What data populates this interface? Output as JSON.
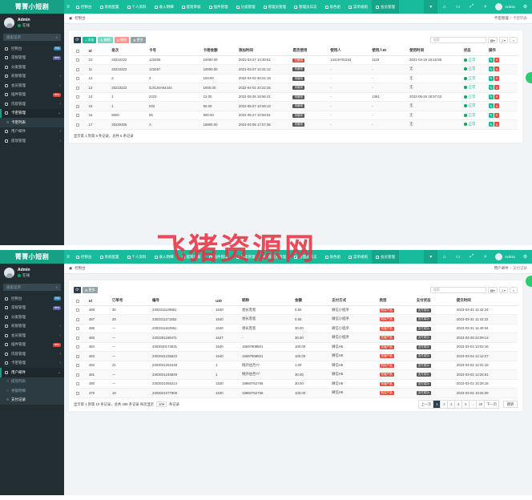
{
  "colors": {
    "accent": "#18bc9c",
    "sidebar": "#222d32",
    "danger": "#e74c3c",
    "dark": "#2c3e50"
  },
  "watermark": "飞猪资源网",
  "shot1": {
    "brand": "菁菁小短剧",
    "user": {
      "name": "Admin",
      "status": "在线"
    },
    "search_placeholder": "搜索菜单",
    "menu": [
      {
        "label": "控制台",
        "badge": "hot",
        "badge_color": "#3c8dbc"
      },
      {
        "label": "常规管理",
        "badge": "new",
        "badge_color": "#605ca8"
      },
      {
        "label": "分类管理",
        "badge": "",
        "badge_color": ""
      },
      {
        "label": "权限管理",
        "badge": "",
        "badge_color": "",
        "chev": true
      },
      {
        "label": "会员管理",
        "badge": "",
        "badge_color": "",
        "chev": true
      },
      {
        "label": "插件管理",
        "badge": "new",
        "badge_color": "#dd4b39"
      },
      {
        "label": "内容管理",
        "badge": "",
        "badge_color": "",
        "chev": true
      },
      {
        "label": "卡密管理",
        "badge": "",
        "badge_color": "",
        "chev": true,
        "active": true
      }
    ],
    "submenu": [
      {
        "label": "卡密列表",
        "current": true
      }
    ],
    "menu_after": [
      {
        "label": "用户邮件",
        "badge": "",
        "badge_color": "",
        "chev": true
      },
      {
        "label": "提现管理",
        "badge": "",
        "badge_color": "",
        "chev": true
      }
    ],
    "tabs": [
      {
        "label": "控制台",
        "icon": "dashboard-icon"
      },
      {
        "label": "系统配置",
        "icon": "cog-icon"
      },
      {
        "label": "个人资料",
        "icon": "user-icon"
      },
      {
        "label": "收入明细",
        "icon": "list-icon"
      },
      {
        "label": "提现审核",
        "icon": "money-icon"
      },
      {
        "label": "插件管理",
        "icon": "plugin-icon"
      },
      {
        "label": "分类管理",
        "icon": "category-icon"
      },
      {
        "label": "管理员管理",
        "icon": "admin-icon"
      },
      {
        "label": "管理员日志",
        "icon": "log-icon"
      },
      {
        "label": "角色组",
        "icon": "group-icon"
      },
      {
        "label": "菜单规则",
        "icon": "menu-icon"
      },
      {
        "label": "会员管理",
        "icon": "member-icon"
      }
    ],
    "active_tab": 11,
    "top_user": "Admin",
    "crumb": {
      "title": "控制台",
      "right": [
        "卡密管理",
        "卡密列表"
      ]
    },
    "toolbar": {
      "add": "添加",
      "edit": "编辑",
      "del": "删除",
      "more": "更多",
      "search": "搜索"
    },
    "columns": [
      "Id",
      "批次",
      "卡号",
      "卡密金额",
      "添加时间",
      "是否使用",
      "使用人",
      "使用人ID",
      "使用时间",
      "状态",
      "操作"
    ],
    "rows": [
      [
        "10",
        "20210222",
        "123456",
        "10000.00",
        "2021-03-27 14:30:51",
        "已使用",
        "13416781153",
        "1119",
        "2021-04-19 16:16:55",
        "正常"
      ],
      [
        "11",
        "20210222",
        "123457",
        "10000.00",
        "2021-03-27 14:31:12",
        "未使用",
        "-",
        "-",
        "无",
        "正常"
      ],
      [
        "12",
        "2",
        "3",
        "100.00",
        "2022-04-02 20:21:19",
        "未使用",
        "-",
        "-",
        "无",
        "正常"
      ],
      [
        "13",
        "20210222",
        "GJGJSA54444",
        "1000.00",
        "2022-04-02 20:22:25",
        "未使用",
        "-",
        "-",
        "无",
        "正常"
      ],
      [
        "14",
        "1",
        "2222",
        "12.00",
        "2022-05-26 18:56:41",
        "未使用",
        "-",
        "1361",
        "2022-05-26 18:57:03",
        "正常"
      ],
      [
        "15",
        "1",
        "033",
        "50.00",
        "2022-05-27 10:59:13",
        "未使用",
        "-",
        "-",
        "无",
        "正常"
      ],
      [
        "16",
        "5000",
        "55",
        "500.00",
        "2022-05-27 10:59:51",
        "未使用",
        "-",
        "-",
        "无",
        "正常"
      ],
      [
        "17",
        "20230305",
        "A",
        "16800.00",
        "2023-03-05 17:07:36",
        "未使用",
        "-",
        "-",
        "无",
        "正常"
      ]
    ],
    "footer": "显示第 1 到第 8 条记录，总共 8 条记录"
  },
  "shot2": {
    "brand": "菁菁小短剧",
    "user": {
      "name": "Admin",
      "status": "在线"
    },
    "search_placeholder": "搜索菜单",
    "menu": [
      {
        "label": "控制台",
        "badge": "hot",
        "badge_color": "#3c8dbc"
      },
      {
        "label": "常规管理",
        "badge": "new",
        "badge_color": "#605ca8"
      },
      {
        "label": "分类管理",
        "badge": "",
        "badge_color": ""
      },
      {
        "label": "权限管理",
        "badge": "",
        "badge_color": "",
        "chev": true
      },
      {
        "label": "会员管理",
        "badge": "",
        "badge_color": "",
        "chev": true
      },
      {
        "label": "插件管理",
        "badge": "new",
        "badge_color": "#dd4b39"
      },
      {
        "label": "内容管理",
        "badge": "",
        "badge_color": "",
        "chev": true
      },
      {
        "label": "卡密管理",
        "badge": "",
        "badge_color": "",
        "chev": true
      },
      {
        "label": "用户邮件",
        "badge": "",
        "badge_color": "",
        "chev": true,
        "active": true
      }
    ],
    "submenu": [
      {
        "label": "提现列表",
        "current": false
      },
      {
        "label": "余额明细",
        "current": false
      },
      {
        "label": "支付记录",
        "current": true
      }
    ],
    "menu_after": [],
    "tabs": [
      {
        "label": "控制台",
        "icon": "dashboard-icon"
      },
      {
        "label": "系统配置",
        "icon": "cog-icon"
      },
      {
        "label": "个人资料",
        "icon": "user-icon"
      },
      {
        "label": "收入明细",
        "icon": "list-icon"
      },
      {
        "label": "提现审核",
        "icon": "money-icon"
      },
      {
        "label": "插件管理",
        "icon": "plugin-icon"
      },
      {
        "label": "分类管理",
        "icon": "category-icon"
      },
      {
        "label": "管理员管理",
        "icon": "admin-icon"
      },
      {
        "label": "管理员日志",
        "icon": "log-icon"
      },
      {
        "label": "角色组",
        "icon": "group-icon"
      },
      {
        "label": "菜单规则",
        "icon": "menu-icon"
      },
      {
        "label": "会员管理",
        "icon": "member-icon"
      }
    ],
    "active_tab": 11,
    "top_user": "Admin",
    "crumb": {
      "title": "控制台",
      "right": [
        "用户邮件",
        "支付记录"
      ]
    },
    "toolbar": {
      "more": "更多",
      "search": "搜索"
    },
    "columns": [
      "Id",
      "订单号",
      "编号",
      "UID",
      "昵称",
      "金额",
      "支付方式",
      "类型",
      "支付状态",
      "提交时间"
    ],
    "rows": [
      [
        "488",
        "30",
        "2303311149961",
        "1640",
        "划长黑客",
        "0.50",
        "微信小程序",
        "购买产品",
        "支付成功",
        "2023-03-31 11:42:24"
      ],
      [
        "487",
        "29",
        "2303311171552",
        "1640",
        "划长黑客",
        "0.50",
        "微信小程序",
        "购买产品",
        "支付成功",
        "2023-03-31 11:42:22"
      ],
      [
        "486",
        "—",
        "2303311162961",
        "1640",
        "划长黑客",
        "30.00",
        "微信小程序",
        "充值产品",
        "支付成功",
        "2023-03-31 11:40:54"
      ],
      [
        "485",
        "—",
        "2303281169471",
        "1647",
        "-",
        "30.00",
        "微信小程序",
        "充值产品",
        "支付成功",
        "2023-03-28 22:09:14"
      ],
      [
        "484",
        "—",
        "2303040174631",
        "1540",
        "15697808801",
        "100.00",
        "微信H5",
        "充值产品",
        "支付成功",
        "2023-03-04 13:02:16"
      ],
      [
        "483",
        "—",
        "2303041235622",
        "1540",
        "15697808801",
        "100.00",
        "微信H5",
        "充值产品",
        "支付成功",
        "2023-03-04 12:12:27"
      ],
      [
        "482",
        "21",
        "2303021261549",
        "1",
        "婉外往西77",
        "1.00",
        "微信H5",
        "购买产品",
        "支付成功",
        "2023-03-02 12:31:16"
      ],
      [
        "481",
        "—",
        "2303021245849",
        "1",
        "婉外往西77",
        "30.00",
        "微信H5",
        "充值产品",
        "支付成功",
        "2023-03-02 12:26:51"
      ],
      [
        "480",
        "—",
        "2303021055214",
        "1530",
        "18960762766",
        "30.00",
        "微信H5",
        "充值产品",
        "支付成功",
        "2023-03-02 10:29:16"
      ],
      [
        "479",
        "19",
        "2303021077809",
        "1530",
        "18960762766",
        "100.00",
        "微信H5",
        "购买产品",
        "支付成功",
        "2023-03-02 10:25:09"
      ]
    ],
    "footer": "显示第 1 到第 10 条记录，总共 488 条记录 每页显示",
    "per_page": "10",
    "footer_tail": "条记录",
    "pages": [
      "上一页",
      "1",
      "2",
      "3",
      "4",
      "5",
      "...",
      "49",
      "下一页"
    ],
    "jump": "跳转"
  }
}
